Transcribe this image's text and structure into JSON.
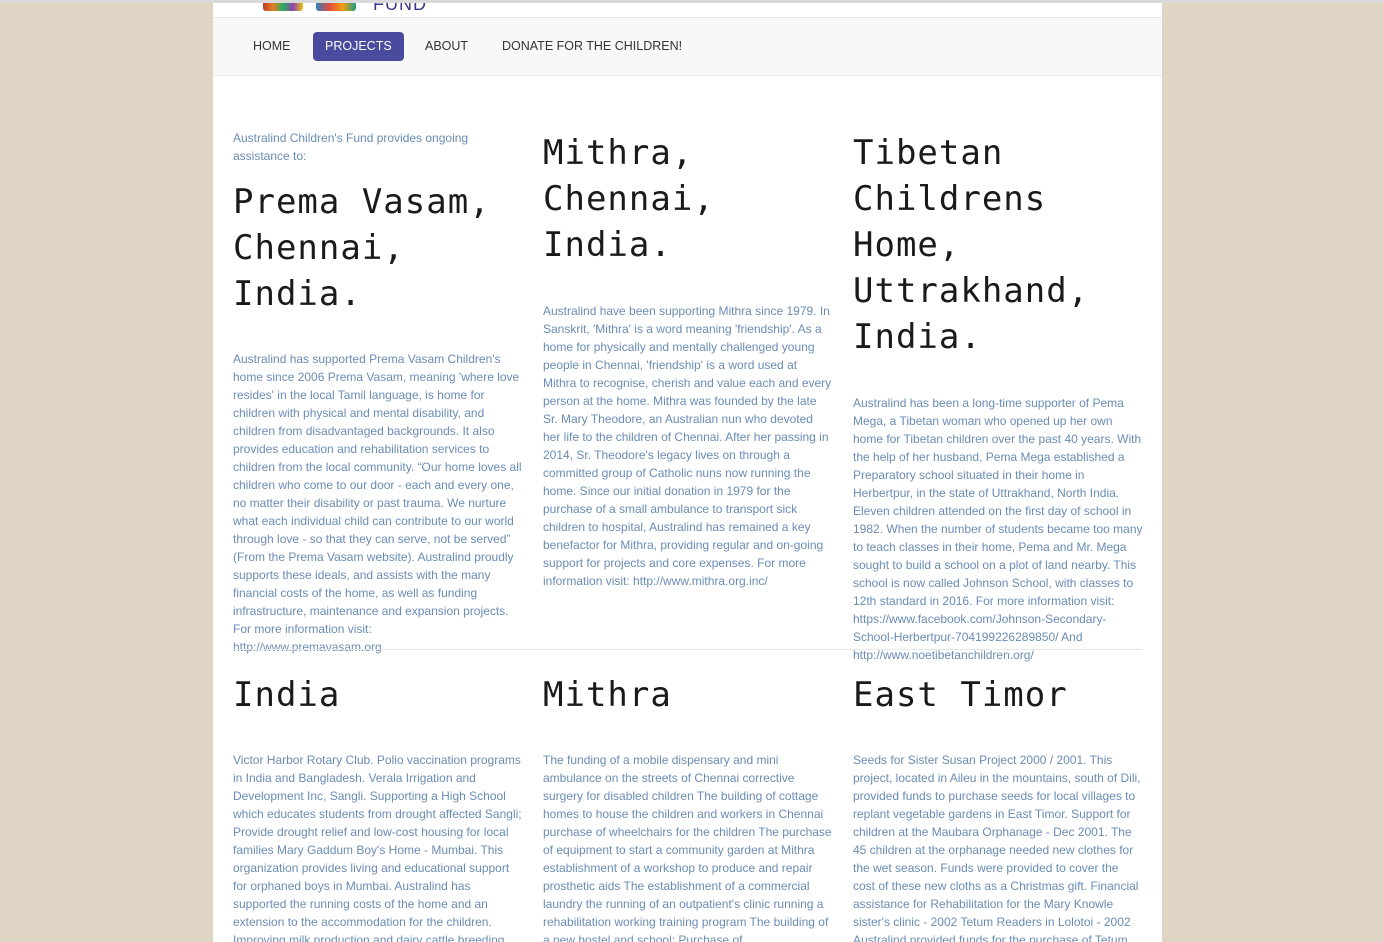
{
  "header": {
    "logo_text": "FUND"
  },
  "nav": {
    "home": "HOME",
    "projects": "PROJECTS",
    "about": "ABOUT",
    "donate": "DONATE FOR THE CHILDREN!"
  },
  "row1": {
    "col1": {
      "intro": "Australind Children's Fund provides ongoing assistance to:",
      "heading": "Prema Vasam, Chennai, India.",
      "body": "Australind has supported Prema Vasam Children's home since 2006 Prema Vasam, meaning 'where love resides' in the local Tamil language, is home for children with physical and mental disability, and children from disadvantaged backgrounds. It also provides education and rehabilitation services to children from the local community. “Our home loves all children who come to our door - each and every one, no matter their disability or past trauma. We nurture what each individual child can contribute to our world through love - so that they can serve, not be served” (From the Prema Vasam website). Australind proudly supports these ideals, and assists with the many financial costs of the home, as well as funding infrastructure, maintenance and expansion projects. For more information visit: http://www.premavasam.org"
    },
    "col2": {
      "heading": "Mithra, Chennai, India.",
      "body": "Australind have been supporting Mithra since 1979. In Sanskrit, 'Mithra' is a word meaning 'friendship'. As a home for physically and mentally challenged young people in Chennai, 'friendship' is a word used at Mithra to recognise, cherish and value each and every person at the home. Mithra was founded by the late Sr. Mary Theodore, an Australian nun who devoted her life to the children of Chennai. After her passing in 2014, Sr. Theodore's legacy lives on through a committed group of Catholic nuns now running the home. Since our initial donation in 1979 for the purchase of a small ambulance to transport sick children to hospital, Australind has remained a key benefactor for Mithra, providing regular and on-going support for projects and core expenses. For more information visit: http://www.mithra.org.inc/"
    },
    "col3": {
      "heading": "Tibetan Childrens Home, Uttrakhand, India.",
      "body": "Australind has been a long-time supporter of Pema Mega, a Tibetan woman who opened up her own home for Tibetan children over the past 40 years. With the help of her husband, Pema Mega established a Preparatory school situated in their home in Herbertpur, in the state of Uttrakhand, North India. Eleven children attended on the first day of school in 1982. When the number of students became too many to teach classes in their home, Pema and Mr. Mega sought to build a school on a plot of land nearby. This school is now called Johnson School, with classes to 12th standard in 2016. For more information visit: https://www.facebook.com/Johnson-Secondary-School-Herbertpur-704199226289850/ And http://www.noetibetanchildren.org/"
    }
  },
  "row2": {
    "col1": {
      "heading": "India",
      "body": "Victor Harbor Rotary Club. Polio vaccination programs in India and Bangladesh. Verala Irrigation and Development Inc, Sangli. Supporting a High School which educates students from drought affected Sangli; Provide drought relief and low-cost housing for local families Mary Gaddum Boy's Home - Mumbai. This organization provides living and educational support for orphaned boys in Mumbai. Australind has supported the running costs of the home and an extension to the accommodation for the children. Improving milk production and dairy cattle breeding"
    },
    "col2": {
      "heading": "Mithra",
      "body": "The funding of a mobile dispensary and mini ambulance on the streets of Chennai corrective surgery for disabled children The building of cottage homes to house the children and workers in Chennai purchase of wheelchairs for the children The purchase of equipment to start a community garden at Mithra establishment of a workshop to produce and repair prosthetic aids The establishment of a commercial laundry the running of an outpatient's clinic running a rehabilitation working training program The building of a new hostel and school; Purchase of"
    },
    "col3": {
      "heading": "East Timor",
      "body": "Seeds for Sister Susan Project 2000 / 2001. This project, located in Aileu in the mountains, south of Dili, provided funds to purchase seeds for local villages to replant vegetable gardens in East Timor. Support for children at the Maubara Orphanage - Dec 2001. The 45 children at the orphanage needed new clothes for the wet season. Funds were provided to cover the cost of these new cloths as a Christmas gift. Financial assistance for Rehabilitation for the Mary Knowle sister's clinic - 2002 Tetum Readers in Lolotoi - 2002 Australind provided funds for the purchase of Tetum"
    }
  }
}
